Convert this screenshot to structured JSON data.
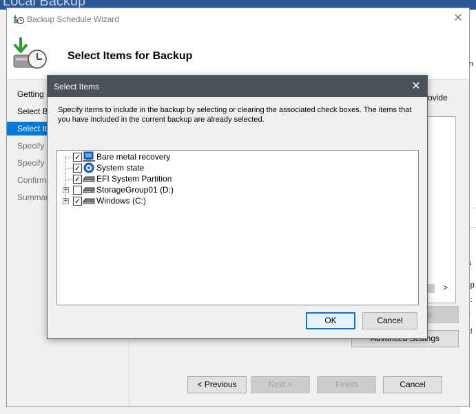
{
  "background": {
    "title": "Local Backup",
    "right_fragments": [
      "orn",
      "ps",
      "kup",
      "py:",
      "py",
      "v d"
    ]
  },
  "wizard": {
    "title": "Backup Schedule Wizard",
    "header_title": "Select Items for Backup",
    "steps": [
      {
        "label": "Getting Started",
        "state": "normal"
      },
      {
        "label": "Select Backup Configuration",
        "state": "normal"
      },
      {
        "label": "Select Items for Backup",
        "state": "selected"
      },
      {
        "label": "Specify Backup Time",
        "state": "disabled"
      },
      {
        "label": "Specify Destination Type",
        "state": "disabled"
      },
      {
        "label": "Confirmation",
        "state": "disabled"
      },
      {
        "label": "Summary",
        "state": "disabled"
      }
    ],
    "content_text": "ovide",
    "buttons": {
      "remove_items": "Remove Items",
      "advanced_settings": "Advanced Settings",
      "previous": "< Previous",
      "next": "Next >",
      "finish": "Finish",
      "cancel": "Cancel"
    }
  },
  "dialog": {
    "title": "Select Items",
    "description": "Specify items to include in the backup by selecting or clearing the associated check boxes. The items that you have included in the current backup are already selected.",
    "tree_items": [
      {
        "label": "Bare metal recovery",
        "checked": true,
        "expandable": false,
        "icon": "bare-metal-icon"
      },
      {
        "label": "System state",
        "checked": true,
        "expandable": false,
        "icon": "system-state-icon"
      },
      {
        "label": "EFI System Partition",
        "checked": true,
        "expandable": false,
        "icon": "drive-icon"
      },
      {
        "label": "StorageGroup01 (D:)",
        "checked": false,
        "expandable": true,
        "icon": "drive-icon"
      },
      {
        "label": "Windows (C:)",
        "checked": true,
        "expandable": true,
        "icon": "drive-icon"
      }
    ],
    "ok_label": "OK",
    "cancel_label": "Cancel"
  }
}
